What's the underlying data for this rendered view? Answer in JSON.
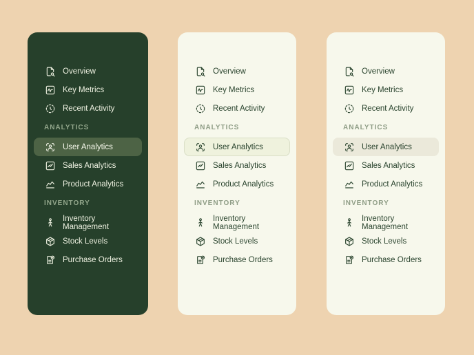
{
  "page": {
    "background_color": "#eed3b0"
  },
  "panels": [
    {
      "variant": "dark",
      "background_color": "#26402b",
      "text_color": "#eef1e1",
      "selected_background_color": "#4d6345"
    },
    {
      "variant": "light-outlined",
      "background_color": "#f7f8ec",
      "text_color": "#2a442e",
      "selected_background_color": "#eff2dd",
      "selected_border_color": "#d9dec6"
    },
    {
      "variant": "light-filled",
      "background_color": "#f7f8ec",
      "text_color": "#2a442e",
      "selected_background_color": "#ebe9da"
    }
  ],
  "menu": {
    "groups": [
      {
        "header": "",
        "items": [
          {
            "label": "Overview",
            "icon": "file-search-icon",
            "selected": false
          },
          {
            "label": "Key Metrics",
            "icon": "chart-square-icon",
            "selected": false
          },
          {
            "label": "Recent Activity",
            "icon": "history-icon",
            "selected": false
          }
        ]
      },
      {
        "header": "ANALYTICS",
        "items": [
          {
            "label": "User Analytics",
            "icon": "user-scan-icon",
            "selected": true
          },
          {
            "label": "Sales Analytics",
            "icon": "chart-box-icon",
            "selected": false
          },
          {
            "label": "Product Analytics",
            "icon": "chart-line-icon",
            "selected": false
          }
        ]
      },
      {
        "header": "INVENTORY",
        "items": [
          {
            "label": "Inventory Management",
            "icon": "person-icon",
            "selected": false
          },
          {
            "label": "Stock Levels",
            "icon": "package-icon",
            "selected": false
          },
          {
            "label": "Purchase Orders",
            "icon": "order-check-icon",
            "selected": false
          }
        ]
      }
    ]
  }
}
